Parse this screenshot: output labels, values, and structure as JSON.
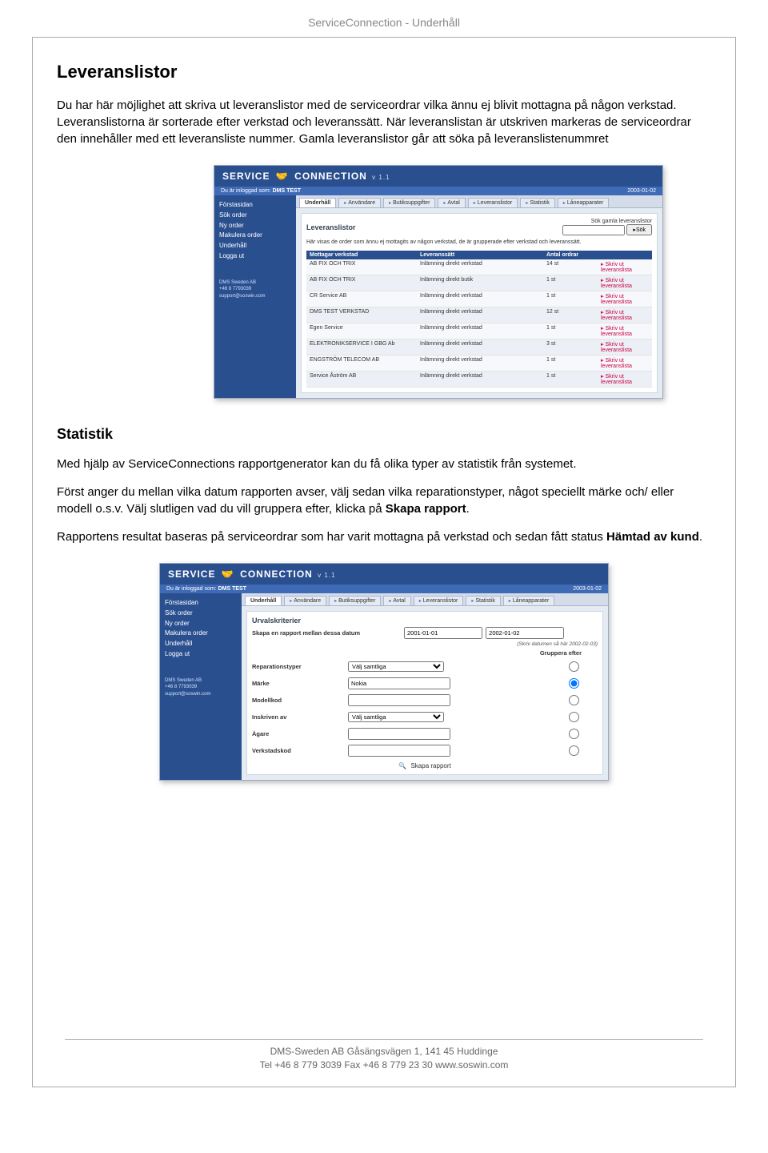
{
  "doc_header": "ServiceConnection - Underhåll",
  "section1_title": "Leveranslistor",
  "section1_p1": "Du har här möjlighet att skriva ut leveranslistor med de serviceordrar vilka ännu ej blivit mottagna på någon verkstad. Leveranslistorna är sorterade efter verkstad och leveranssätt. När leveranslistan är utskriven markeras de serviceordrar den innehåller med ett leveransliste nummer. Gamla leveranslistor går att söka på leveranslistenummret",
  "section2_title": "Statistik",
  "section2_p1": "Med hjälp av ServiceConnections rapportgenerator kan du få olika typer av statistik från systemet.",
  "section2_p2a": "Först anger du mellan vilka datum rapporten avser, välj sedan vilka reparationstyper, något speciellt märke och/ eller modell o.s.v. Välj slutligen vad du vill gruppera efter, klicka på ",
  "section2_p2b": "Skapa rapport",
  "section2_p2c": ".",
  "section2_p3a": "Rapportens resultat baseras på serviceordrar som har varit mottagna på verkstad och sedan fått status ",
  "section2_p3b": "Hämtad av kund",
  "section2_p3c": ".",
  "footer_line1": "DMS-Sweden AB Gåsängsvägen 1, 141 45 Huddinge",
  "footer_line2": "Tel +46 8 779 3039 Fax +46 8 779 23 30 www.soswin.com",
  "app_title_a": "SERVICE",
  "app_title_b": "CONNECTION",
  "app_version": "v 1.1",
  "logged_in_prefix": "Du är inloggad som: ",
  "logged_in_user": "DMS TEST",
  "date_stamp": "2003-01-02",
  "side_nav": [
    "Förstasidan",
    "Sök order",
    "Ny order",
    "Makulera order",
    "Underhåll",
    "Logga ut"
  ],
  "support_company": "DMS Sweden AB",
  "support_phone": "+46 8 7793039",
  "support_email": "support@soswin.com",
  "tabs": [
    "Underhåll",
    "Användare",
    "Butiksuppgifter",
    "Avtal",
    "Leveranslistor",
    "Statistik",
    "Låneapparater"
  ],
  "s1_panel_title": "Leveranslistor",
  "s1_search_label": "Sök gamla leveranslistor",
  "s1_search_button": "Sök",
  "s1_desc": "Här visas de order som ännu ej mottagits av någon verkstad, de är grupperade efter verkstad och leveranssätt.",
  "s1_head": [
    "Mottagar verkstad",
    "Leveranssätt",
    "Antal ordrar",
    ""
  ],
  "s1_print": "Skriv ut leveranslista",
  "s1_rows": [
    {
      "a": "AB FIX OCH TRIX",
      "b": "Inlämning direkt verkstad",
      "c": "14 st"
    },
    {
      "a": "AB FIX OCH TRIX",
      "b": "Inlämning direkt butik",
      "c": "1 st"
    },
    {
      "a": "CR Service AB",
      "b": "Inlämning direkt verkstad",
      "c": "1 st"
    },
    {
      "a": "DMS TEST VERKSTAD",
      "b": "Inlämning direkt verkstad",
      "c": "12 st"
    },
    {
      "a": "Egen Service",
      "b": "Inlämning direkt verkstad",
      "c": "1 st"
    },
    {
      "a": "ELEKTRONIKSERVICE I GBG Ab",
      "b": "Inlämning direkt verkstad",
      "c": "3 st"
    },
    {
      "a": "ENGSTRÖM TELECOM AB",
      "b": "Inlämning direkt verkstad",
      "c": "1 st"
    },
    {
      "a": "Service Åström AB",
      "b": "Inlämning direkt verkstad",
      "c": "1 st"
    }
  ],
  "s2_panel_title": "Urvalskriterier",
  "s2_date_label": "Skapa en rapport mellan dessa datum",
  "s2_date_from": "2001-01-01",
  "s2_date_to": "2002-01-02",
  "s2_date_hint": "(Skriv datumen så här 2002-02-03)",
  "s2_group_label": "Gruppera efter",
  "s2_fields": {
    "reparationstyper": {
      "label": "Reparationstyper",
      "value": "Välj samtliga"
    },
    "marke": {
      "label": "Märke",
      "value": "Nokia"
    },
    "modellkod": {
      "label": "Modellkod"
    },
    "inskriven": {
      "label": "Inskriven av",
      "value": "Välj samtliga"
    },
    "agare": {
      "label": "Ägare"
    },
    "verkstad": {
      "label": "Verkstadskod"
    }
  },
  "s2_create": "Skapa rapport"
}
